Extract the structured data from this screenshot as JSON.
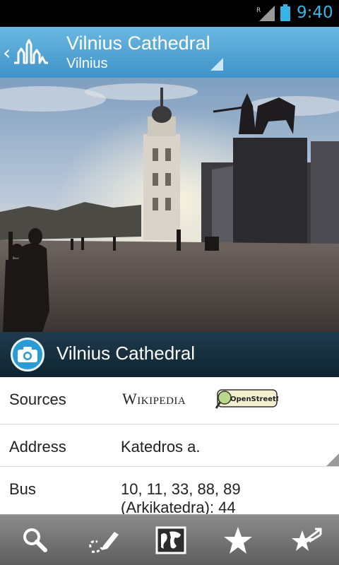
{
  "status_bar": {
    "time": "9:40",
    "roaming_indicator": "R",
    "icons": [
      "signal-icon",
      "battery-icon"
    ]
  },
  "action_bar": {
    "back_icon": "chevron-left-icon",
    "logo_icon": "city-skyline-logo-icon",
    "title": "Vilnius Cathedral",
    "subtitle": "Vilnius"
  },
  "photo": {
    "caption": "Vilnius Cathedral",
    "caption_icon": "camera-icon"
  },
  "details": [
    {
      "key": "Sources",
      "wikipedia_logo": "Wikipedia",
      "osm_logo": "OpenStreetMap"
    },
    {
      "key": "Address",
      "value": "Katedros a."
    },
    {
      "key": "Bus",
      "value": "10, 11, 33, 88, 89 (Arkikatedra): 44"
    }
  ],
  "toolbar": {
    "items": [
      {
        "name": "search",
        "icon": "search-icon"
      },
      {
        "name": "edit",
        "icon": "edit-route-icon"
      },
      {
        "name": "map",
        "icon": "map-icon"
      },
      {
        "name": "favorites",
        "icon": "star-icon"
      },
      {
        "name": "featured",
        "icon": "star-arrow-icon"
      }
    ]
  },
  "colors": {
    "accent": "#33b5e5",
    "action_bar": "#4ea3d3",
    "caption_bar": "#173241",
    "toolbar": "#737373"
  }
}
